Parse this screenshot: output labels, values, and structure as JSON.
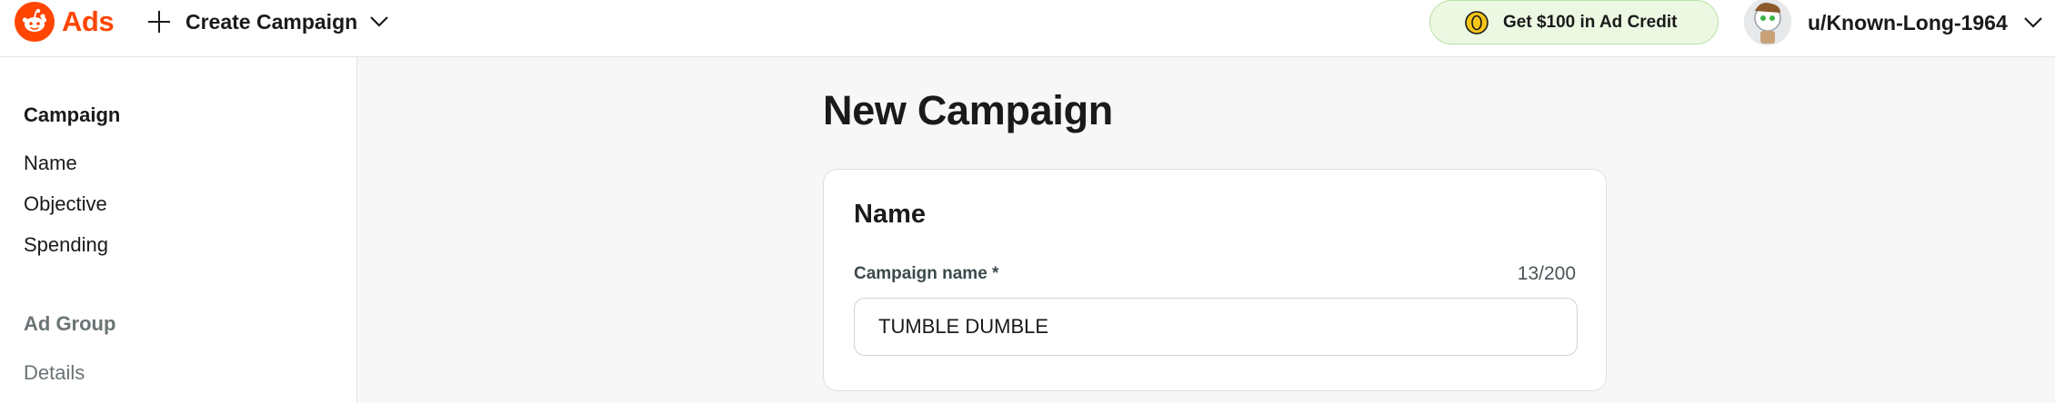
{
  "brand": {
    "name": "Ads",
    "accent_color": "#ff4500",
    "icon": "reddit-logo-icon"
  },
  "header": {
    "create_label": "Create Campaign",
    "credit_label": "Get $100 in Ad Credit",
    "username": "u/Known-Long-1964"
  },
  "sidebar": {
    "campaign_section": {
      "title": "Campaign",
      "items": [
        "Name",
        "Objective",
        "Spending"
      ]
    },
    "ad_group_section": {
      "title": "Ad Group",
      "items": [
        "Details"
      ]
    }
  },
  "main": {
    "page_title": "New Campaign",
    "card": {
      "title": "Name",
      "field_label": "Campaign name *",
      "counter": "13/200",
      "value": "TUMBLE DUMBLE"
    }
  }
}
